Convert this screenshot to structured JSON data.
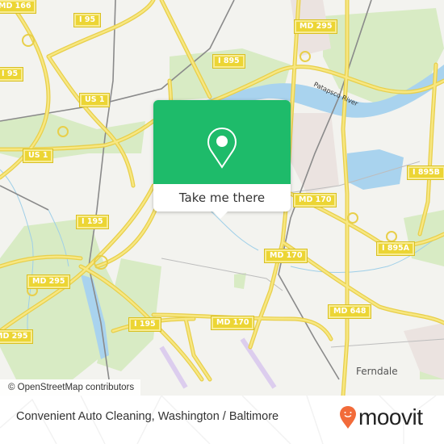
{
  "map": {
    "road_shields": [
      {
        "label": "MD 166",
        "id": "md166"
      },
      {
        "label": "I 95",
        "id": "i95-top"
      },
      {
        "label": "I 95",
        "id": "i95-left"
      },
      {
        "label": "US 1",
        "id": "us1-upper"
      },
      {
        "label": "US 1",
        "id": "us1-lower"
      },
      {
        "label": "MD 295",
        "id": "md295-top"
      },
      {
        "label": "I 895",
        "id": "i895"
      },
      {
        "label": "I 895B",
        "id": "i895b"
      },
      {
        "label": "MD 170",
        "id": "md170-upper"
      },
      {
        "label": "I 895A",
        "id": "i895a"
      },
      {
        "label": "MD 170",
        "id": "md170-mid"
      },
      {
        "label": "I 195",
        "id": "i195-upper"
      },
      {
        "label": "MD 295",
        "id": "md295-left"
      },
      {
        "label": "MD 648",
        "id": "md648"
      },
      {
        "label": "I 195",
        "id": "i195-lower"
      },
      {
        "label": "MD 170",
        "id": "md170-lower"
      },
      {
        "label": "MD 295",
        "id": "md295-bottom"
      }
    ],
    "places": {
      "ferndale": "Ferndale",
      "river": "Patapsco River"
    },
    "attribution": "© OpenStreetMap contributors"
  },
  "popup": {
    "button_label": "Take me there",
    "icon": "map-pin-icon",
    "color": "#1ebb6a"
  },
  "footer": {
    "title": "Convenient Auto Cleaning, Washington / Baltimore",
    "brand": "moovit",
    "brand_color": "#f26b3a"
  }
}
